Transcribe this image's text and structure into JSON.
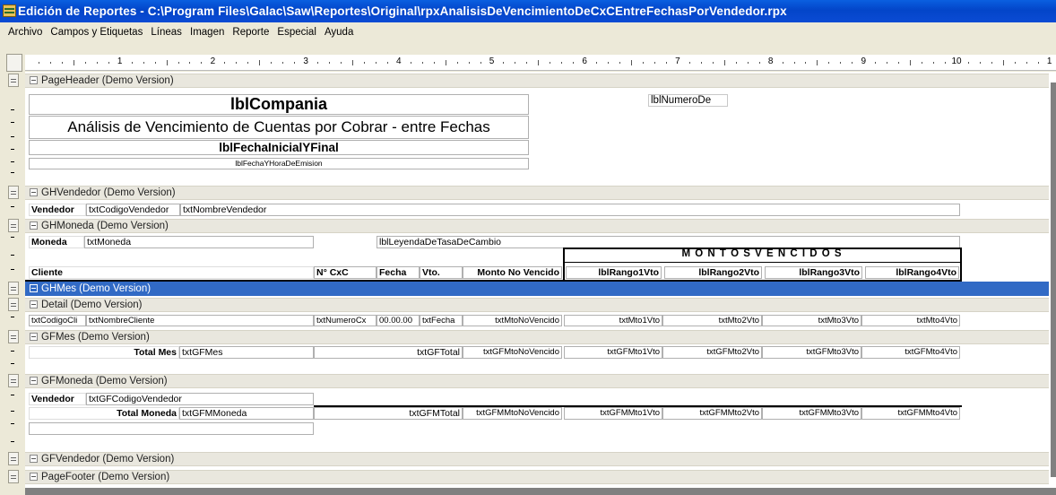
{
  "window": {
    "title": "Edición de Reportes - C:\\Program Files\\Galac\\Saw\\Reportes\\Original\\rpxAnalisisDeVencimientoDeCxCEntreFechasPorVendedor.rpx"
  },
  "menu": [
    "Archivo",
    "Campos y Etiquetas",
    "Líneas",
    "Imagen",
    "Reporte",
    "Especial",
    "Ayuda"
  ],
  "ruler": {
    "numbers": [
      "1",
      "2",
      "3",
      "4",
      "5",
      "6",
      "7",
      "8",
      "9",
      "10",
      "1"
    ]
  },
  "bands": {
    "page_header": "PageHeader (Demo Version)",
    "gh_vendedor": "GHVendedor (Demo Version)",
    "gh_moneda": "GHMoneda (Demo Version)",
    "gh_mes": "GHMes (Demo Version)",
    "detail": "Detail (Demo Version)",
    "gf_mes": "GFMes (Demo Version)",
    "gf_moneda": "GFMoneda (Demo Version)",
    "gf_vendedor": "GFVendedor (Demo Version)",
    "page_footer": "PageFooter (Demo Version)"
  },
  "page_header": {
    "compania": "lblCompania",
    "titulo": "Análisis de Vencimiento de Cuentas por Cobrar - entre Fechas",
    "fechas": "lblFechaInicialYFinal",
    "emision": "lblFechaYHoraDeEmision",
    "numero_de": "lblNumeroDe"
  },
  "gh_vendedor": {
    "label": "Vendedor",
    "codigo": "txtCodigoVendedor",
    "nombre": "txtNombreVendedor"
  },
  "gh_moneda": {
    "label": "Moneda",
    "moneda": "txtMoneda",
    "leyenda": "lblLeyendaDeTasaDeCambio",
    "montos_vencidos": "M O N T O S   V E N C I D O S",
    "columns": [
      "Cliente",
      "N° CxC",
      "Fecha",
      "Vto.",
      "Monto No Vencido",
      "lblRango1Vto",
      "lblRango2Vto",
      "lblRango3Vto",
      "lblRango4Vto"
    ]
  },
  "detail": {
    "fields": [
      "txtCodigoCli",
      "txtNombreCliente",
      "txtNumeroCx",
      "00.00.00",
      "txtFecha",
      "txtMtoNoVencido",
      "txtMto1Vto",
      "txtMto2Vto",
      "txtMto3Vto",
      "txtMto4Vto"
    ]
  },
  "gf_mes": {
    "label": "Total Mes",
    "mes": "txtGFMes",
    "total": "txtGFTotal",
    "values": [
      "txtGFMtoNoVencido",
      "txtGFMto1Vto",
      "txtGFMto2Vto",
      "txtGFMto3Vto",
      "txtGFMto4Vto"
    ]
  },
  "gf_moneda": {
    "vendedor_label": "Vendedor",
    "vendedor": "txtGFCodigoVendedor",
    "label": "Total Moneda",
    "moneda": "txtGFMMoneda",
    "total": "txtGFMTotal",
    "values": [
      "txtGFMMtoNoVencido",
      "txtGFMMto1Vto",
      "txtGFMMto2Vto",
      "txtGFMMto3Vto",
      "txtGFMMto4Vto"
    ]
  }
}
